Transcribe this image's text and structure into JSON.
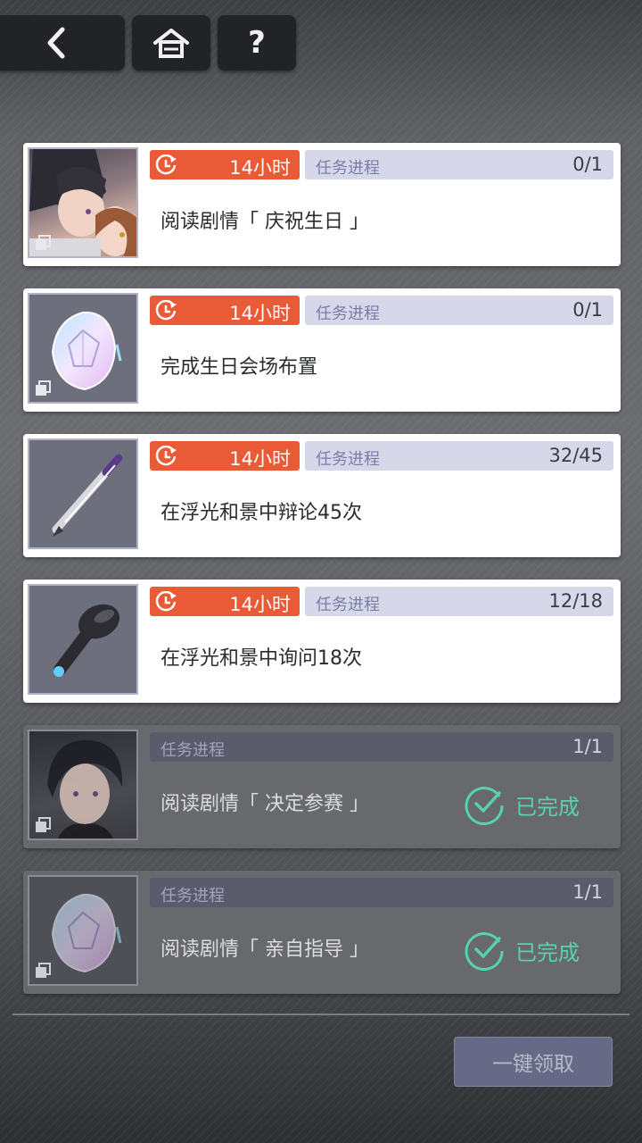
{
  "header": {
    "back_icon": "chevron-left-icon",
    "home_icon": "home-icon",
    "help_label": "?"
  },
  "tasks": [
    {
      "timer": "14小时",
      "progress_label": "任务进程",
      "progress": "0/1",
      "description": "阅读剧情「 庆祝生日 」",
      "thumbnail": "character-couple-portrait",
      "completed": false
    },
    {
      "timer": "14小时",
      "progress_label": "任务进程",
      "progress": "0/1",
      "description": "完成生日会场布置",
      "thumbnail": "crystal-gem-icon",
      "completed": false
    },
    {
      "timer": "14小时",
      "progress_label": "任务进程",
      "progress": "32/45",
      "description": "在浮光和景中辩论45次",
      "thumbnail": "pen-icon",
      "completed": false
    },
    {
      "timer": "14小时",
      "progress_label": "任务进程",
      "progress": "12/18",
      "description": "在浮光和景中询问18次",
      "thumbnail": "earphone-icon",
      "completed": false
    },
    {
      "progress_label": "任务进程",
      "progress": "1/1",
      "description": "阅读剧情「 决定参赛 」",
      "thumbnail": "character-portrait",
      "completed": true,
      "status": "已完成"
    },
    {
      "progress_label": "任务进程",
      "progress": "1/1",
      "description": "阅读剧情「 亲自指导 」",
      "thumbnail": "crystal-gem-icon",
      "completed": true,
      "status": "已完成"
    }
  ],
  "footer": {
    "claim_all_label": "一键领取"
  },
  "colors": {
    "timer": "#e95a37",
    "progress_bg": "#d6d8ea",
    "done_green": "#57d3a7",
    "claim_button": "#676a86"
  }
}
